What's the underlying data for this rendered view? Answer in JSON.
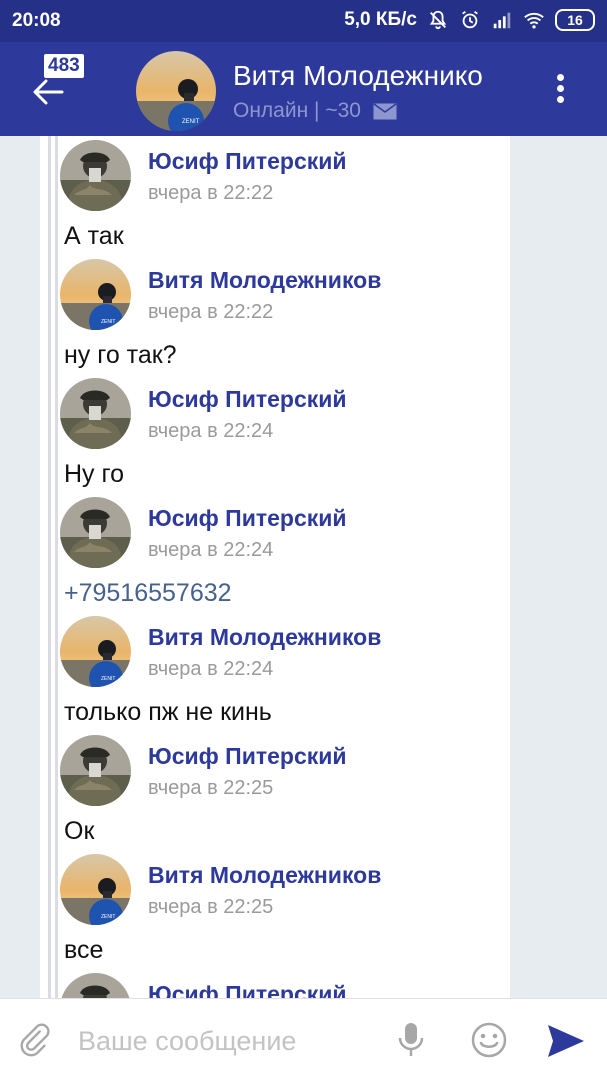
{
  "status_bar": {
    "time": "20:08",
    "speed": "5,0 КБ/с",
    "battery": "16"
  },
  "header": {
    "unread_count": "483",
    "name": "Витя Молодежнико",
    "status": "Онлайн | ~30"
  },
  "messages": [
    {
      "author": "Юсиф Питерский",
      "date": "вчера в 22:22",
      "text": "А так",
      "avatar": "yusif"
    },
    {
      "author": "Витя Молодежников",
      "date": "вчера в 22:22",
      "text": "ну го так?",
      "avatar": "vitya"
    },
    {
      "author": "Юсиф Питерский",
      "date": "вчера в 22:24",
      "text": "Ну го",
      "avatar": "yusif"
    },
    {
      "author": "Юсиф Питерский",
      "date": "вчера в 22:24",
      "text": "+79516557632",
      "avatar": "yusif",
      "is_link": true
    },
    {
      "author": "Витя Молодежников",
      "date": "вчера в 22:24",
      "text": "только пж не кинь",
      "avatar": "vitya"
    },
    {
      "author": "Юсиф Питерский",
      "date": "вчера в 22:25",
      "text": "Ок",
      "avatar": "yusif"
    },
    {
      "author": "Витя Молодежников",
      "date": "вчера в 22:25",
      "text": "все",
      "avatar": "vitya"
    },
    {
      "author": "Юсиф Питерский",
      "date": "",
      "text": "",
      "avatar": "yusif"
    }
  ],
  "composer": {
    "placeholder": "Ваше сообщение"
  },
  "colors": {
    "status_bar": "#253188",
    "toolbar": "#2d3a9c",
    "author": "#2d3a9c",
    "link": "#46628c",
    "send": "#2d3a9c"
  }
}
